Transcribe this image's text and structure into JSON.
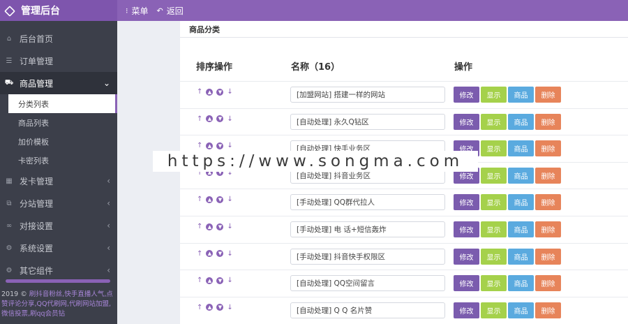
{
  "header": {
    "brand": "管理后台",
    "menu_label": "菜单",
    "back_label": "返回"
  },
  "sidebar": {
    "items": [
      {
        "label": "后台首页",
        "icon": "home-icon"
      },
      {
        "label": "订单管理",
        "icon": "list-icon"
      },
      {
        "label": "商品管理",
        "icon": "cart-icon"
      },
      {
        "label": "发卡管理",
        "icon": "grid-icon"
      },
      {
        "label": "分站管理",
        "icon": "sitemap-icon"
      },
      {
        "label": "对接设置",
        "icon": "link-icon"
      },
      {
        "label": "系统设置",
        "icon": "gear-icon"
      },
      {
        "label": "其它组件",
        "icon": "gears-icon"
      }
    ],
    "sub_items": [
      "分类列表",
      "商品列表",
      "加价模板",
      "卡密列表"
    ],
    "footer": {
      "year": "2019 ©",
      "text": "刷抖音粉丝,快手直播人气,点赞评论分享,QQ代刷网,代刷网站加盟,微信投票,刷qq会员钻"
    }
  },
  "main": {
    "panel_title": "商品分类",
    "columns": {
      "sort": "排序操作",
      "name": "名称（16）",
      "ops": "操作"
    },
    "buttons": {
      "edit": "修改",
      "show": "显示",
      "goods": "商品",
      "delete": "删除"
    },
    "rows": [
      {
        "name": "[加盟网站] 搭建一样的网站"
      },
      {
        "name": "[自动处理] 永久Q钻区"
      },
      {
        "name": "[自动处理] 快手业务区"
      },
      {
        "name": "[自动处理] 抖音业务区"
      },
      {
        "name": "[手动处理] QQ群代拉人"
      },
      {
        "name": "[手动处理] 电 话+短信轰炸"
      },
      {
        "name": "[手动处理] 抖音快手权限区"
      },
      {
        "name": "[自动处理] QQ空间留言"
      },
      {
        "name": "[自动处理] Q Q 名片赞"
      }
    ]
  },
  "watermark": "https://www.songma.com",
  "colors": {
    "accent": "#8a62b6",
    "sidebar_bg": "#3c3f4a",
    "edit": "#7b5cae",
    "show": "#a5d14b",
    "goods": "#5aaadf",
    "delete": "#e7845a"
  }
}
